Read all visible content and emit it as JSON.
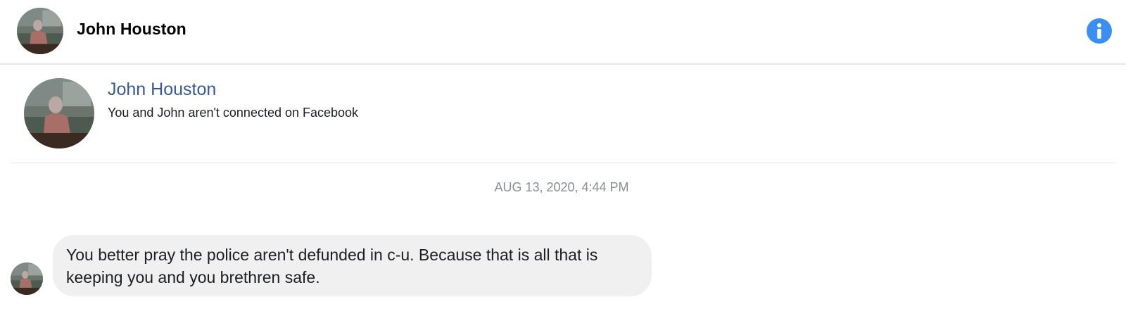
{
  "header": {
    "title": "John Houston",
    "avatar_icon": "profile-photo",
    "info_icon": "info-icon",
    "info_color": "#3b8ff0"
  },
  "profile": {
    "name": "John Houston",
    "status": "You and John aren't connected on Facebook",
    "name_color": "#385898"
  },
  "conversation": {
    "timestamp": "AUG 13, 2020, 4:44 PM",
    "messages": [
      {
        "text": "You better pray the police aren't defunded in c-u. Because that is all that is keeping you and you brethren safe."
      }
    ]
  }
}
